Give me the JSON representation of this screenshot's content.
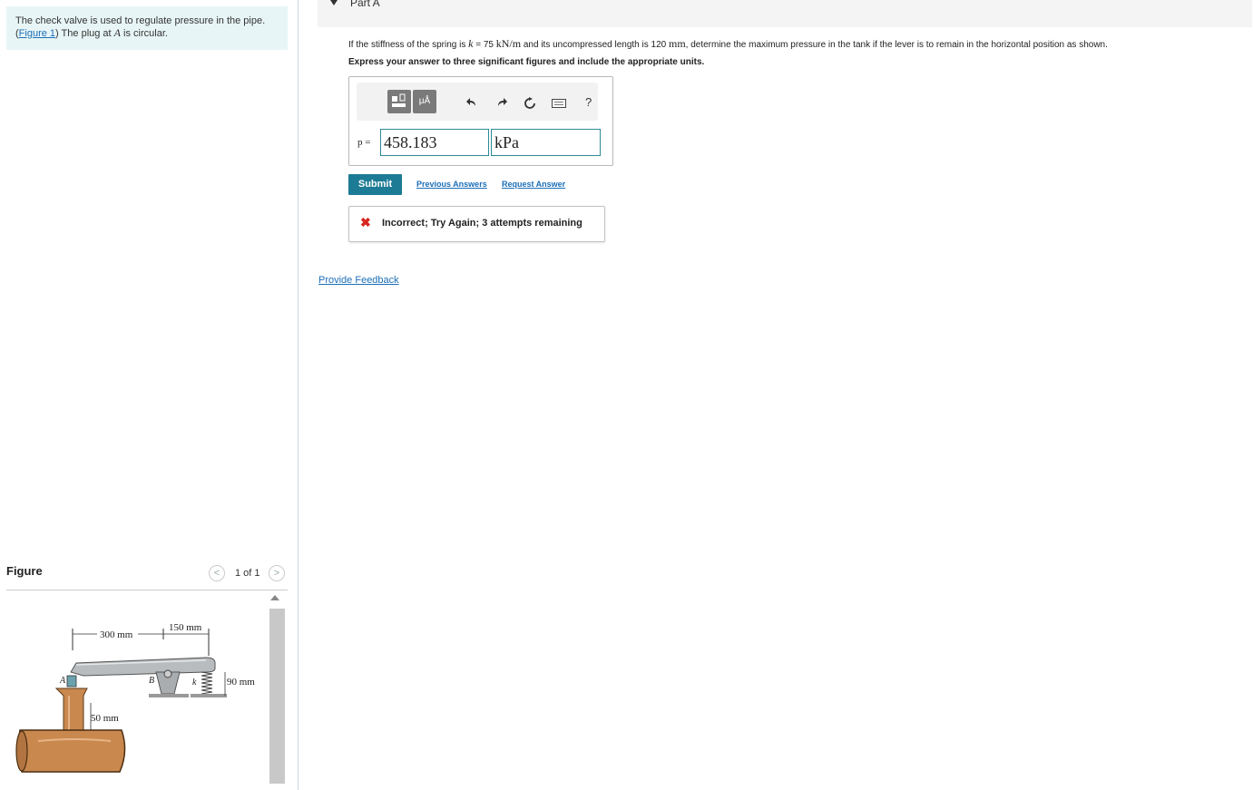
{
  "intro": {
    "line1": "The check valve is used to regulate pressure in the pipe.",
    "figure_link": "Figure 1",
    "line2_rest": " The plug at ",
    "plug_var": "A",
    "line2_end": " is circular."
  },
  "figure": {
    "title": "Figure",
    "pager": "1 of 1",
    "prev": "<",
    "next": ">",
    "labels": {
      "dim_300": "300 mm",
      "dim_150": "150 mm",
      "dim_90": "90 mm",
      "dim_50": "50 mm",
      "point_a": "A",
      "point_b": "B",
      "spring_k": "k"
    }
  },
  "part": {
    "title": "Part A",
    "question_pre": "If the stiffness of the spring is ",
    "question_k": "k",
    "question_k_val": " = 75 ",
    "question_k_unit": "kN/m",
    "question_mid": " and its uncompressed length is 120 ",
    "question_len_unit": "mm",
    "question_post": ", determine the maximum pressure in the tank if the lever is to remain in the horizontal position as shown.",
    "instruction": "Express your answer to three significant figures and include the appropriate units."
  },
  "toolbar": {
    "templates_icon": "templates-icon",
    "units_label": "μÅ",
    "undo_icon": "undo-icon",
    "redo_icon": "redo-icon",
    "reset_icon": "reset-icon",
    "keyboard_icon": "keyboard-icon",
    "help_label": "?"
  },
  "answer": {
    "variable": "p =",
    "value": "458.183",
    "units": "kPa"
  },
  "actions": {
    "submit": "Submit",
    "previous_answers": "Previous Answers",
    "request_answer": "Request Answer"
  },
  "feedback": {
    "icon": "✖",
    "message": "Incorrect; Try Again; 3 attempts remaining"
  },
  "footer": {
    "provide_feedback": "Provide Feedback"
  },
  "colors": {
    "accent": "#1d7b95",
    "link": "#1c6fb8",
    "error": "#d7261f",
    "intro_bg": "#e8f5f6"
  }
}
